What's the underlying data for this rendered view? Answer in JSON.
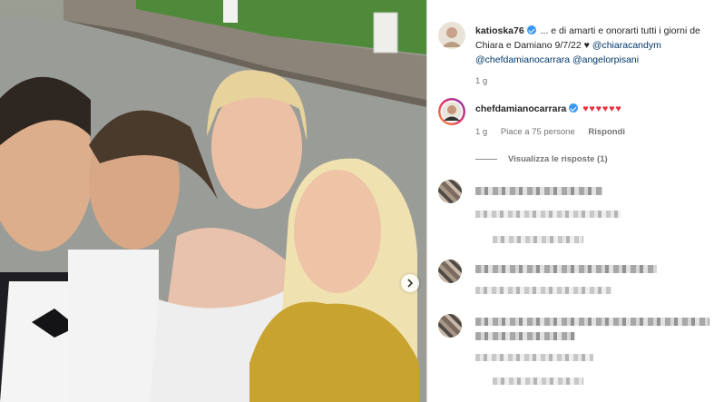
{
  "post": {
    "username": "katioska76",
    "caption_text": " ... e di amarti e onorarti tutti i giorni de",
    "caption_line2": "Chiara e Damiano 9/7/22 ♥ ",
    "mentions": [
      "@chiaracandym",
      "@chefdamianocarrara",
      "@angelorpisani"
    ],
    "time": "1 g"
  },
  "reply": {
    "username": "chefdamianocarrara",
    "hearts": "♥♥♥♥♥♥",
    "time": "1 g",
    "likes": "Piace a 75 persone",
    "reply_label": "Rispondi",
    "view_replies": "Visualizza le risposte (1)"
  },
  "colors": {
    "verified": "#3897f0",
    "link": "#00376b",
    "heart": "#ed2e3b"
  },
  "icons": [
    "verified-badge-icon",
    "chevron-right-icon"
  ]
}
